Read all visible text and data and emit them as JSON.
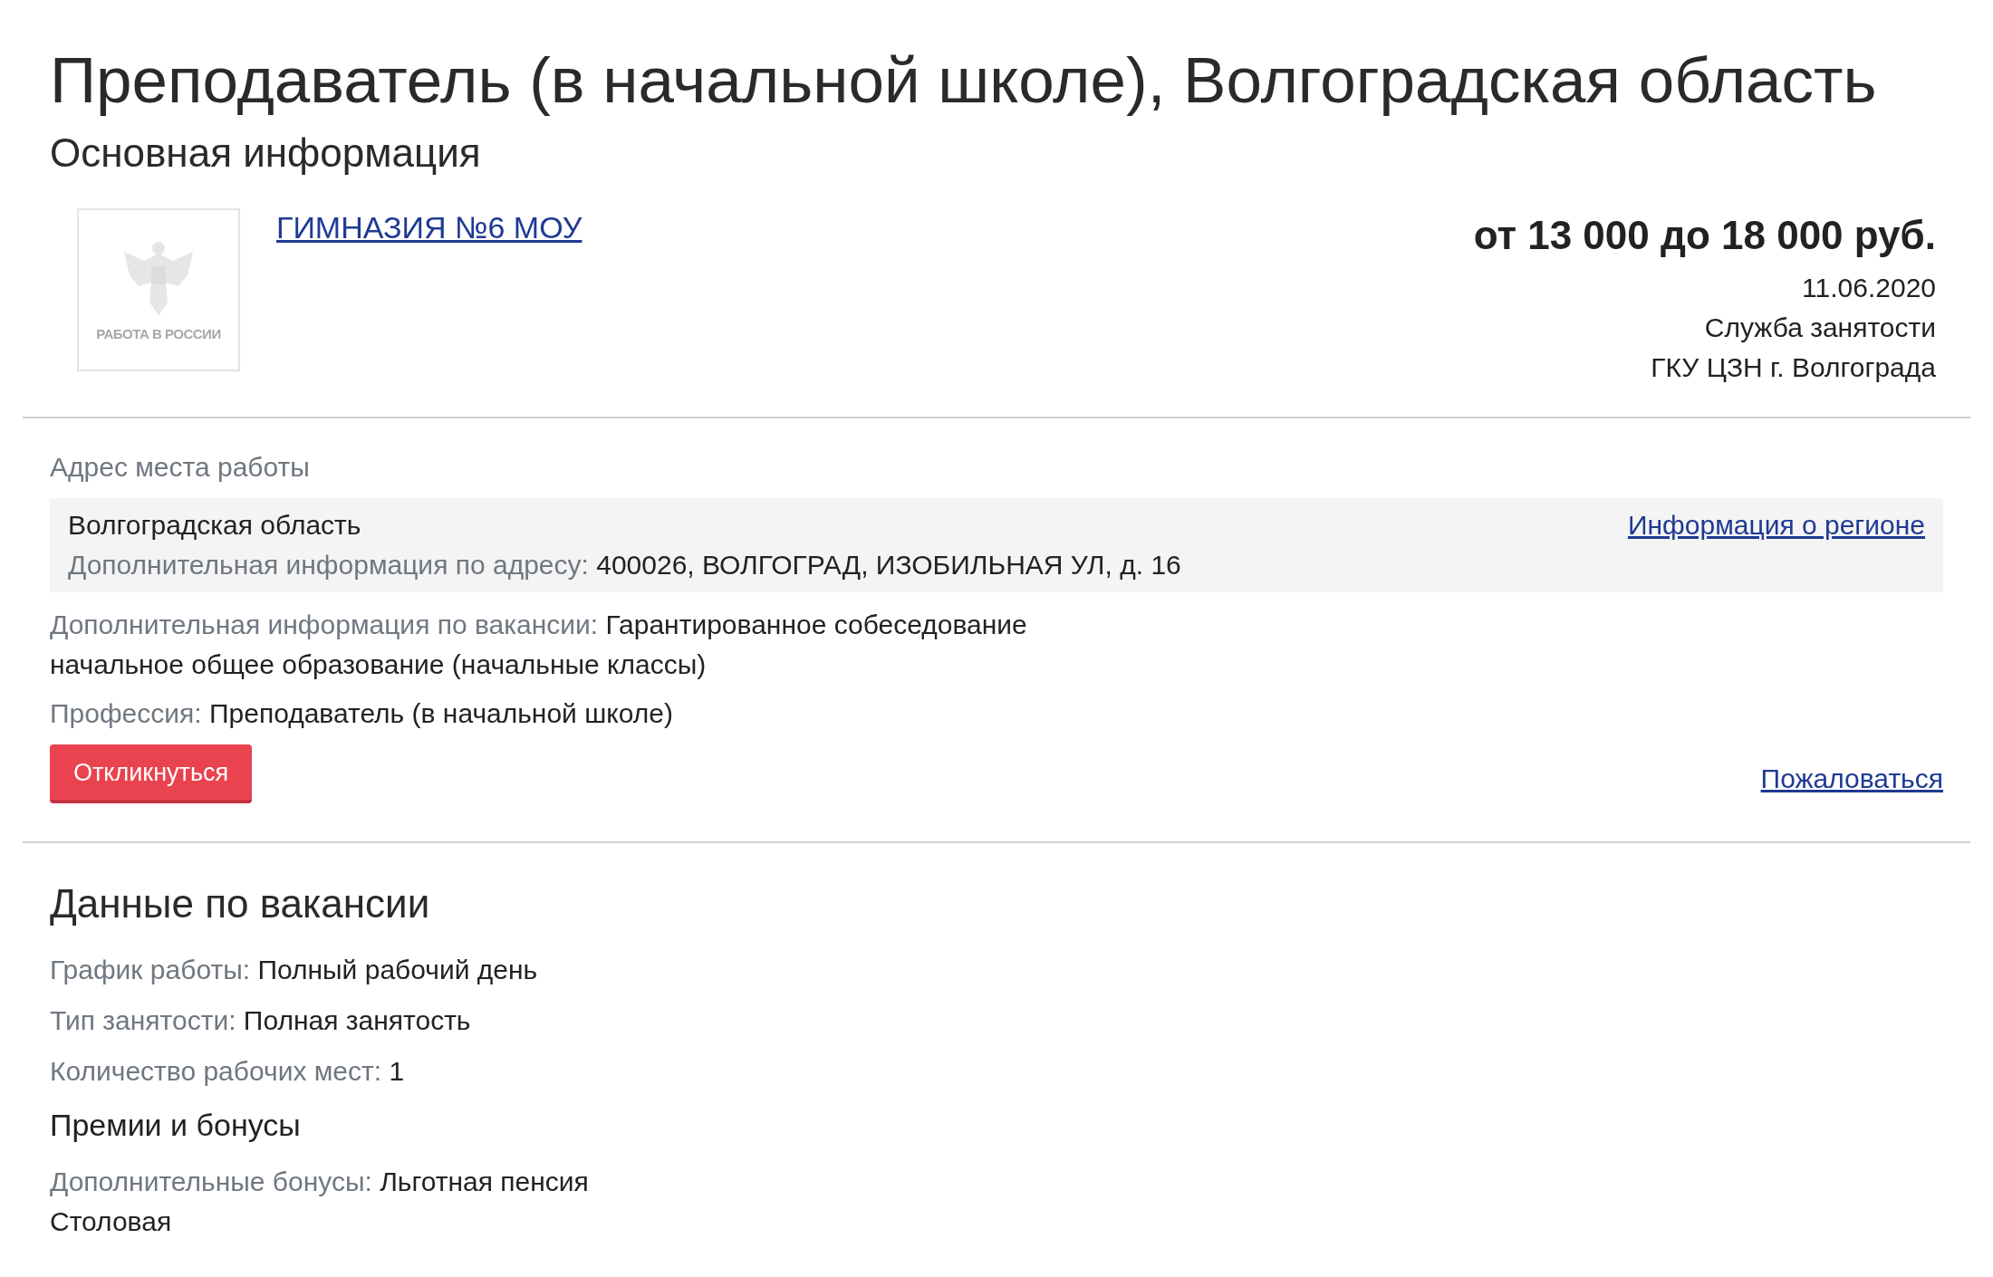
{
  "title": "Преподаватель (в начальной школе), Волгоградская область",
  "subtitle": "Основная информация",
  "employer": {
    "logo_caption": "РАБОТА В РОССИИ",
    "name": "ГИМНАЗИЯ №6 МОУ"
  },
  "salary": "от 13 000 до 18 000 руб.",
  "date": "11.06.2020",
  "source_lines": [
    "Служба занятости",
    "ГКУ ЦЗН г. Волгограда"
  ],
  "address": {
    "label": "Адрес места работы",
    "region": "Волгоградская область",
    "region_link": "Информация о регионе",
    "detail_label": "Дополнительная информация по адресу:",
    "detail_value": "400026, ВОЛГОГРАД, ИЗОБИЛЬНАЯ УЛ, д. 16"
  },
  "vacancy_info": {
    "label": "Дополнительная информация по вакансии:",
    "lines": [
      "Гарантированное собеседование",
      "начальное общее образование (начальные классы)"
    ]
  },
  "profession": {
    "label": "Профессия:",
    "value": "Преподаватель (в начальной школе)"
  },
  "respond_button": "Откликнуться",
  "complain_link": "Пожаловаться",
  "details": {
    "heading": "Данные по вакансии",
    "fields": [
      {
        "label": "График работы:",
        "value": "Полный рабочий день"
      },
      {
        "label": "Тип занятости:",
        "value": "Полная занятость"
      },
      {
        "label": "Количество рабочих мест:",
        "value": "1"
      }
    ],
    "bonuses_heading": "Премии и бонусы",
    "bonuses": {
      "label": "Дополнительные бонусы:",
      "values": [
        "Льготная пенсия",
        "Столовая"
      ]
    }
  }
}
